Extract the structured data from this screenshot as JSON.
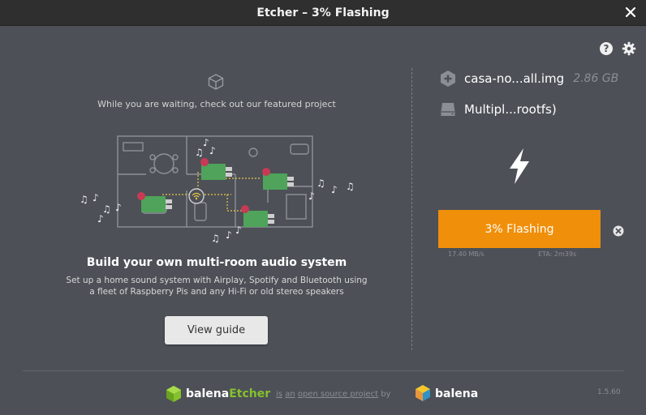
{
  "window": {
    "title": "Etcher – 3% Flashing"
  },
  "icons": {
    "close": "close-icon",
    "help": "question-icon",
    "settings": "gear-icon",
    "cube": "cube-icon",
    "image": "plus-icon",
    "drive": "hdd-icon",
    "flash": "lightning-icon",
    "cancel": "cancel-icon"
  },
  "featured": {
    "waiting_text": "While you are waiting, check out our featured project",
    "title": "Build your own multi-room audio system",
    "description": "Set up a home sound system with Airplay, Spotify and Bluetooth using a fleet of Raspberry Pis and any Hi-Fi or old stereo speakers",
    "button": "View guide"
  },
  "image": {
    "name": "casa-no...all.img",
    "size": "2.86 GB"
  },
  "drive": {
    "name": "Multipl...rootfs)"
  },
  "flashing": {
    "label": "3% Flashing",
    "progress": 0.03,
    "speed": "17.40 MB/s",
    "eta": "ETA: 2m39s"
  },
  "footer": {
    "brand_prefix": "balena",
    "brand_suffix": "Etcher",
    "tag_is": "is",
    "tag_an": "an",
    "tag_link": "open source project",
    "tag_by": "by",
    "company": "balena",
    "version": "1.5.60"
  },
  "colors": {
    "accent": "#f08f0a",
    "background": "#4d5057",
    "titlebar": "#2f2f2f",
    "etcher_green": "#85c12d"
  }
}
